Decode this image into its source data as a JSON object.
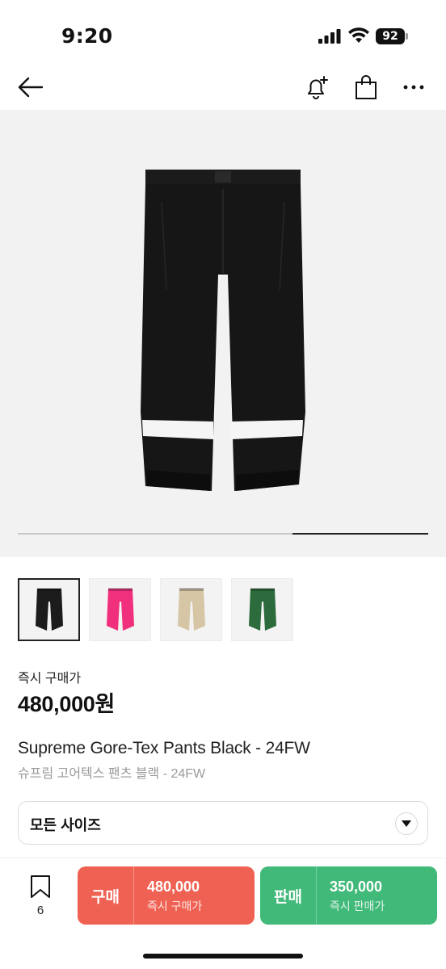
{
  "status_bar": {
    "time": "9:20",
    "battery": "92"
  },
  "nav": {
    "icons": [
      "back-arrow-icon",
      "bell-plus-icon",
      "shopping-bag-icon",
      "more-icon"
    ]
  },
  "gallery": {
    "progress": 0.33,
    "thumbnails": [
      {
        "color": "black",
        "hex": "#1c1c1c",
        "selected": true
      },
      {
        "color": "pink",
        "hex": "#f0307c",
        "selected": false
      },
      {
        "color": "beige",
        "hex": "#d6c6a6",
        "selected": false
      },
      {
        "color": "green",
        "hex": "#2c6b3c",
        "selected": false
      }
    ]
  },
  "price": {
    "label": "즉시 구매가",
    "value": "480,000원"
  },
  "product": {
    "title_en": "Supreme Gore-Tex Pants Black - 24FW",
    "title_ko": "슈프림 고어텍스 팬츠 블랙 - 24FW"
  },
  "size_select": {
    "value": "모든 사이즈"
  },
  "bottom_bar": {
    "bookmark_count": "6",
    "buy": {
      "label": "구매",
      "price": "480,000",
      "sub": "즉시 구매가",
      "color": "#ef6253"
    },
    "sell": {
      "label": "판매",
      "price": "350,000",
      "sub": "즉시 판매가",
      "color": "#41b979"
    }
  }
}
